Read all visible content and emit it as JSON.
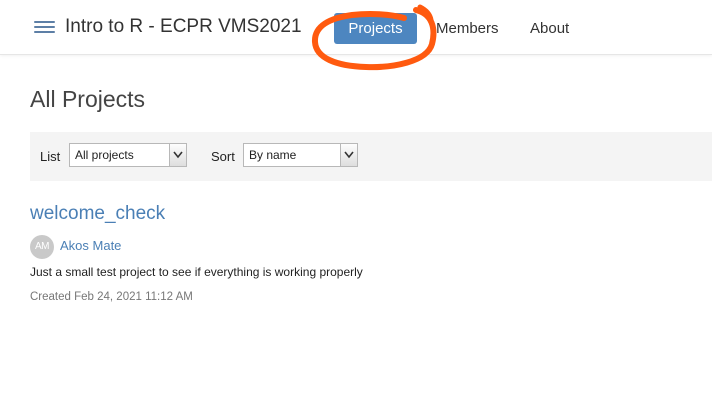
{
  "header": {
    "menu_icon": "hamburger-icon",
    "title": "Intro to R - ECPR VMS2021",
    "nav": {
      "projects": "Projects",
      "members": "Members",
      "about": "About"
    },
    "active_nav_color": "#4d86c0",
    "annotation_color": "#ff5a0f"
  },
  "main": {
    "heading": "All Projects",
    "filters": {
      "list_label": "List",
      "list_value": "All projects",
      "sort_label": "Sort",
      "sort_value": "By name"
    },
    "projects": [
      {
        "title": "welcome_check",
        "owner_initials": "AM",
        "owner": "Akos Mate",
        "description": "Just a small test project to see if everything is working properly",
        "created": "Created Feb 24, 2021 11:12 AM"
      }
    ]
  },
  "colors": {
    "link": "#4a7fb5",
    "filter_bar_bg": "#f4f4f4"
  }
}
